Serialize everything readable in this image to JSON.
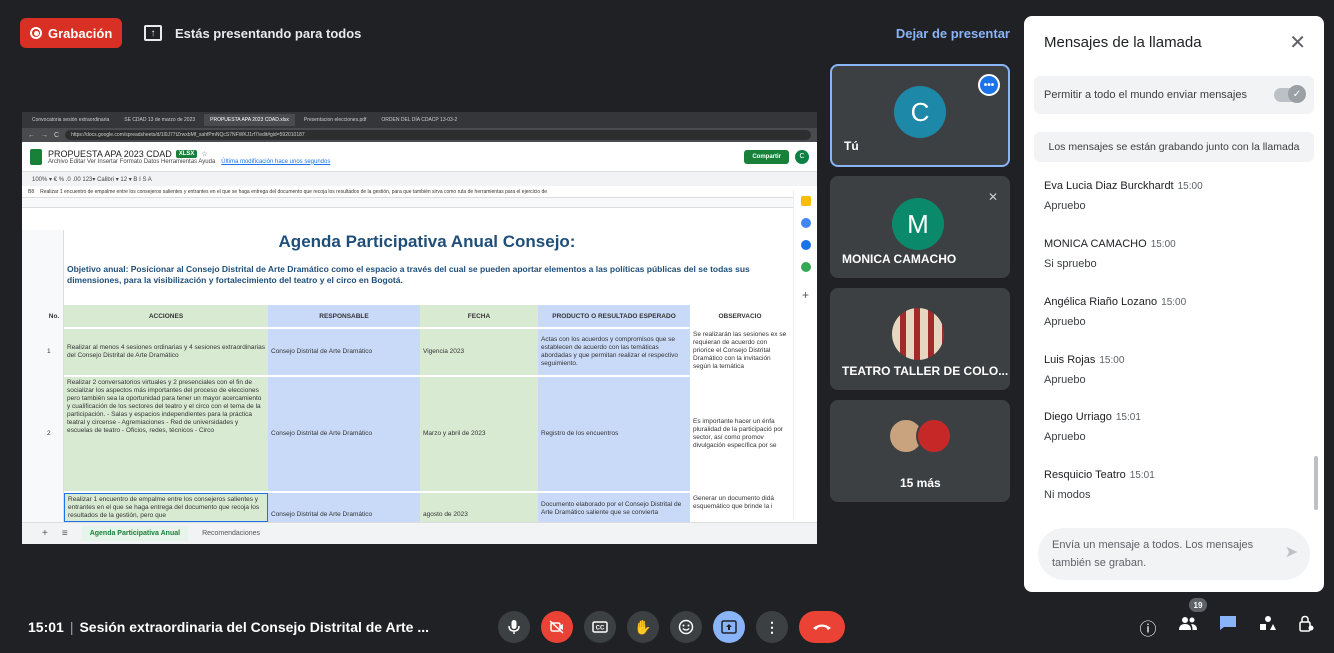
{
  "banner": {
    "record_label": "Grabación",
    "presenting_text": "Estás presentando para todos",
    "stop_presenting": "Dejar de presentar"
  },
  "screen": {
    "tabs": [
      "Convocatoria sesión extraordinaria",
      "SE CDAD 13 de marzo de 2023",
      "PROPUESTA APA 2023 CDAD.xlsx",
      "Presentacion elecciones.pdf",
      "ORDEN DEL DÍA CDACP 13-03-2"
    ],
    "url": "https://docs.google.com/spreadsheets/d/1l0J77tZrwxbMf_sahfPmNQcS7NFWKJ1rf7/edit#gid=592010187",
    "doc_title": "PROPUESTA APA 2023 CDAD",
    "doc_badge": "XLSX",
    "menu": "Archivo  Editar  Ver  Insertar  Formato  Datos  Herramientas  Ayuda",
    "last_edit": "Última modificación hace unos segundos",
    "share_label": "Compartir",
    "avatar_letter": "C",
    "toolbar": "100%  ▾  €  %  .0  .00  123▾  Calibri  ▾  12  ▾  B  I  S  A",
    "cell_ref": "B8",
    "formula": "Realizar 1 encuentro de empalme entre los consejeros salientes y entrantes en el que se haga entrega del documento que recoja los resultados de la gestión, para que también sirva como ruta de herramientas para el ejercicio de",
    "title": "Agenda Participativa Anual Consejo:",
    "objective": "Objetivo anual: Posicionar al Consejo Distrital de Arte Dramático como el espacio a través del cual se pueden aportar elementos a las políticas públicas del se todas sus dimensiones, para la visibilización y fortalecimiento del teatro y el circo en Bogotá.",
    "headers": {
      "no": "No.",
      "acciones": "ACCIONES",
      "responsable": "RESPONSABLE",
      "fecha": "FECHA",
      "producto": "PRODUCTO O RESULTADO ESPERADO",
      "obs": "OBSERVACIO"
    },
    "rows": [
      {
        "rownum": "6",
        "no": "1",
        "accion": "Realizar al menos 4 sesiones ordinarias y 4 sesiones extraordinarias del Consejo Distrital de Arte Dramático",
        "responsable": "Consejo Distrital de Arte Dramático",
        "fecha": "Vigencia 2023",
        "producto": "Actas con los acuerdos y compromisos que se establecen de acuerdo con las temáticas abordadas y que permitan realizar el respectivo seguimiento.",
        "obs": "Se realizarán las sesiones ex se requieran de acuerdo con priorice el Consejo Distrital Dramático con la invitación según la temática"
      },
      {
        "rownum": "7",
        "no": "2",
        "accion": "Realizar 2 conversatorios virtuales y 2 presenciales con el fin de socializar los aspectos más importantes del proceso de elecciones pero también sea la oportunidad para tener un mayor acercamiento y cualificación de los sectores del teatro y el circo con el tema de la participación. - Salas y espacios independientes para la práctica teatral y circense - Agremiaciones - Red de universidades y escuelas de teatro - Oficios, redes, técnicos - Circo",
        "responsable": "Consejo Distrital de Arte Dramático",
        "fecha": "Marzo y abril de 2023",
        "producto": "Registro de los encuentros",
        "obs": "Es importante hacer un énfa pluralidad de la participació por sector, así como promov divulgación específica por se"
      },
      {
        "rownum": "8",
        "no": "",
        "accion": "Realizar 1 encuentro de empalme entre los consejeros salientes y entrantes en el que se haga entrega del documento que recoja los resultados de la gestión, pero que",
        "responsable": "Consejo Distrital de Arte Dramático",
        "fecha": "agosto de 2023",
        "producto": "Documento elaborado por el Consejo Distrital de Arte Dramático saliente que se convierta",
        "obs": "Generar un documento didá esquemático que brinde la i"
      }
    ],
    "sheet_tabs": [
      "Agenda Participativa Anual",
      "Recomendaciones"
    ]
  },
  "tiles": [
    {
      "name": "Tú",
      "letter": "C",
      "color": "#1e88a8"
    },
    {
      "name": "MONICA CAMACHO",
      "letter": "M",
      "color": "#0b8a6b"
    },
    {
      "name": "TEATRO TALLER DE COLO..."
    },
    {
      "name": "15 más"
    }
  ],
  "chat": {
    "title": "Mensajes de la llamada",
    "allow_label": "Permitir a todo el mundo enviar mensajes",
    "record_note": "Los mensajes se están grabando junto con la llamada",
    "messages": [
      {
        "author": "Eva Lucia Diaz Burckhardt",
        "time": "15:00",
        "text": "Apruebo"
      },
      {
        "author": "MONICA CAMACHO",
        "time": "15:00",
        "text": "Si spruebo"
      },
      {
        "author": "Angélica Riaño Lozano",
        "time": "15:00",
        "text": "Apruebo"
      },
      {
        "author": "Luis Rojas",
        "time": "15:00",
        "text": "Apruebo"
      },
      {
        "author": "Diego Urriago",
        "time": "15:01",
        "text": "Apruebo"
      },
      {
        "author": "Resquicio Teatro",
        "time": "15:01",
        "text": "Ni modos"
      }
    ],
    "input_placeholder": "Envía un mensaje a todos. Los mensajes también se graban."
  },
  "bottom": {
    "time": "15:01",
    "meeting_title": "Sesión extraordinaria del Consejo Distrital de Arte ...",
    "participants_count": "19"
  },
  "colors": {
    "red": "#ea4335",
    "blue": "#8ab4f8",
    "dark": "#202124",
    "tile": "#3c4043"
  }
}
